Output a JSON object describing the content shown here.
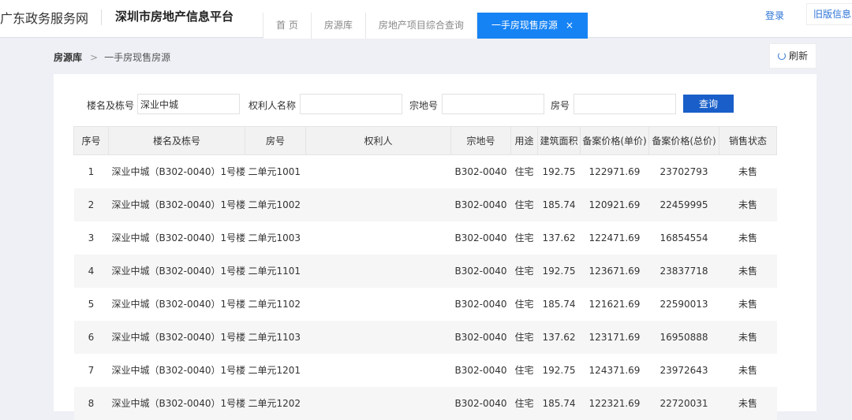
{
  "header": {
    "gov_site": "广东政务服务网",
    "platform": "深圳市房地产信息平台",
    "login": "登录",
    "old_version": "旧版信息"
  },
  "tabs": [
    {
      "label": "首 页"
    },
    {
      "label": "房源库"
    },
    {
      "label": "房地产项目综合查询"
    },
    {
      "label": "一手房现售房源",
      "close": "×"
    }
  ],
  "breadcrumb": {
    "root": "房源库",
    "sep": ">",
    "current": "一手房现售房源"
  },
  "refresh_label": "刷新",
  "search": {
    "building_label": "楼名及栋号",
    "building_value": "深业中城",
    "owner_label": "权利人名称",
    "owner_value": "",
    "land_label": "宗地号",
    "land_value": "",
    "room_label": "房号",
    "room_value": "",
    "query_label": "查询"
  },
  "table": {
    "headers": [
      "序号",
      "楼名及栋号",
      "房号",
      "权利人",
      "宗地号",
      "用途",
      "建筑面积",
      "备案价格(单价)",
      "备案价格(总价)",
      "销售状态"
    ],
    "rows": [
      [
        "1",
        "深业中城（B302-0040）1号楼",
        "二单元1001",
        "",
        "B302-0040",
        "住宅",
        "192.75",
        "122971.69",
        "23702793",
        "未售"
      ],
      [
        "2",
        "深业中城（B302-0040）1号楼",
        "二单元1002",
        "",
        "B302-0040",
        "住宅",
        "185.74",
        "120921.69",
        "22459995",
        "未售"
      ],
      [
        "3",
        "深业中城（B302-0040）1号楼",
        "二单元1003",
        "",
        "B302-0040",
        "住宅",
        "137.62",
        "122471.69",
        "16854554",
        "未售"
      ],
      [
        "4",
        "深业中城（B302-0040）1号楼",
        "二单元1101",
        "",
        "B302-0040",
        "住宅",
        "192.75",
        "123671.69",
        "23837718",
        "未售"
      ],
      [
        "5",
        "深业中城（B302-0040）1号楼",
        "二单元1102",
        "",
        "B302-0040",
        "住宅",
        "185.74",
        "121621.69",
        "22590013",
        "未售"
      ],
      [
        "6",
        "深业中城（B302-0040）1号楼",
        "二单元1103",
        "",
        "B302-0040",
        "住宅",
        "137.62",
        "123171.69",
        "16950888",
        "未售"
      ],
      [
        "7",
        "深业中城（B302-0040）1号楼",
        "二单元1201",
        "",
        "B302-0040",
        "住宅",
        "192.75",
        "124371.69",
        "23972643",
        "未售"
      ],
      [
        "8",
        "深业中城（B302-0040）1号楼",
        "二单元1202",
        "",
        "B302-0040",
        "住宅",
        "185.74",
        "122321.69",
        "22720031",
        "未售"
      ]
    ]
  }
}
